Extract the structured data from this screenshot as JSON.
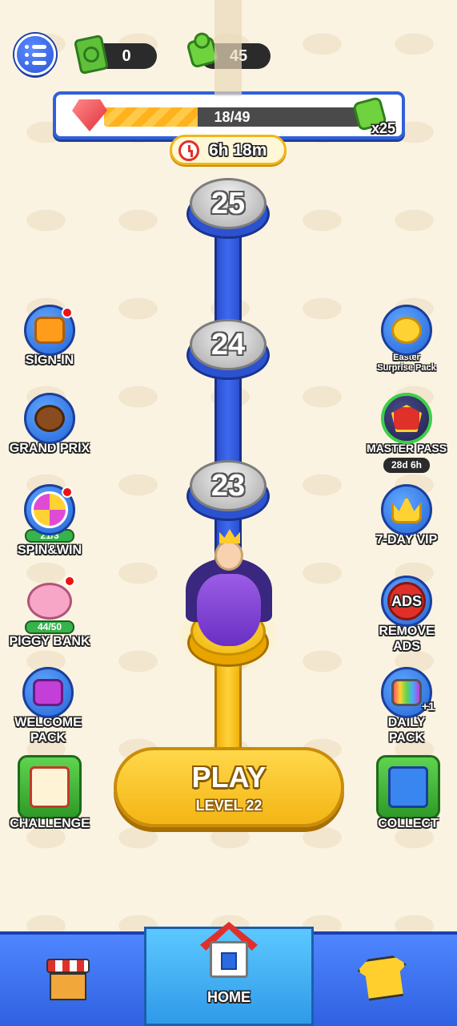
{
  "header": {
    "tickets": "0",
    "puzzles": "45"
  },
  "progress": {
    "text": "18/49",
    "fraction": 0.367,
    "reward": "x25"
  },
  "timer": "6h 18m",
  "levels": [
    {
      "num": "25"
    },
    {
      "num": "24"
    },
    {
      "num": "23"
    }
  ],
  "left_buttons": {
    "signin": "SIGN-IN",
    "grandprix": "GRAND PRIX",
    "spin": "SPIN&WIN",
    "spin_badge": "21/3",
    "piggy": "PIGGY BANK",
    "piggy_badge": "44/50",
    "welcome_line1": "WELCOME",
    "welcome_line2": "PACK",
    "challenge": "CHALLENGE"
  },
  "right_buttons": {
    "easter_line1": "Easter",
    "easter_line2": "Surprise Pack",
    "masterpass": "MASTER PASS",
    "masterpass_badge": "28d 6h",
    "vip": "7-DAY VIP",
    "ads_icon": "ADS",
    "removeads_line1": "REMOVE",
    "removeads_line2": "ADS",
    "daily_line1": "DAILY",
    "daily_line2": "PACK",
    "daily_plus": "+1",
    "collect": "COLLECT"
  },
  "play": {
    "title": "PLAY",
    "subtitle": "LEVEL 22"
  },
  "nav": {
    "home": "HOME"
  },
  "colors": {
    "background": "#fbf3e2",
    "accent_blue": "#3160d8",
    "play_yellow": "#f4b515",
    "progress_fill": "#ffb21e"
  }
}
